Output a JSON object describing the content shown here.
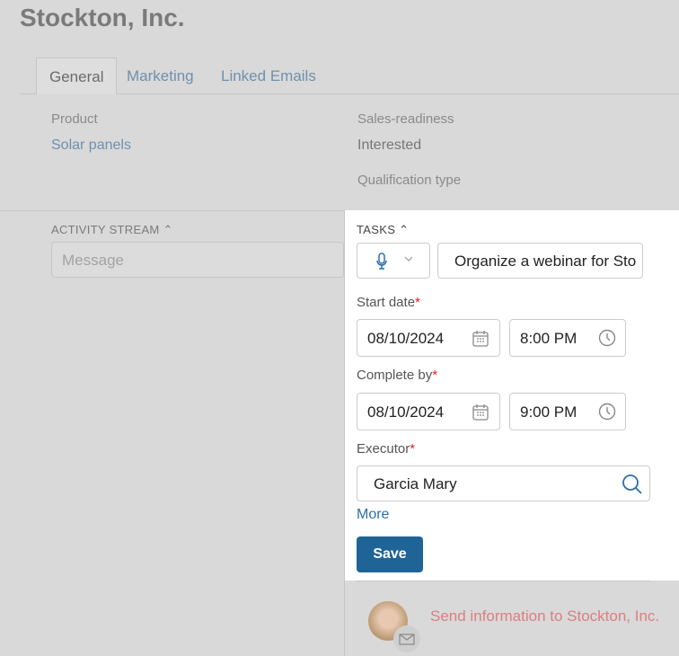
{
  "title": "Stockton, Inc.",
  "tabs": [
    {
      "label": "General"
    },
    {
      "label": "Marketing"
    },
    {
      "label": "Linked Emails"
    }
  ],
  "fields": {
    "product_label": "Product",
    "product_value": "Solar panels",
    "sales_label": "Sales-readiness",
    "sales_value": "Interested",
    "qual_label": "Qualification type"
  },
  "activity": {
    "header": "ACTIVITY STREAM",
    "message_placeholder": "Message"
  },
  "tasks": {
    "header": "TASKS",
    "task_name": "Organize a webinar for Sto",
    "start_label": "Start date",
    "start_date": "08/10/2024",
    "start_time": "8:00 PM",
    "complete_label": "Complete by",
    "complete_date": "08/10/2024",
    "complete_time": "9:00 PM",
    "executor_label": "Executor",
    "executor_value": "Garcia Mary",
    "required_mark": "*",
    "more": "More",
    "save": "Save"
  },
  "feed": {
    "item_text": "Send information to Stockton, Inc."
  },
  "colors": {
    "accent": "#1f6496",
    "link": "#2a6fa8",
    "feed_link": "#d98080"
  }
}
